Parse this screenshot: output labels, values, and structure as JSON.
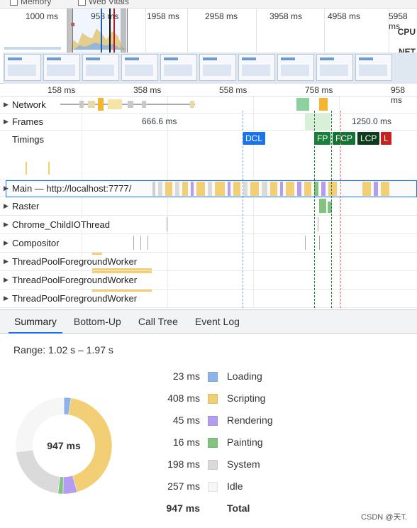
{
  "top_options": {
    "memory": "Memory",
    "web_vitals": "Web Vitals"
  },
  "overview": {
    "ticks": [
      "1000 ms",
      "958 ms",
      "1958 ms",
      "2958 ms",
      "3958 ms",
      "4958 ms",
      "5958 ms"
    ],
    "cpu_label": "CPU",
    "net_label": "NET"
  },
  "ruler": [
    "158 ms",
    "358 ms",
    "558 ms",
    "758 ms",
    "958 ms"
  ],
  "tracks": {
    "network": "Network",
    "frames": "Frames",
    "frames_time_1": "666.6 ms",
    "frames_time_2": "1250.0 ms",
    "timings": "Timings",
    "main": "Main — http://localhost:7777/",
    "raster": "Raster",
    "chrome_child": "Chrome_ChildIOThread",
    "compositor": "Compositor",
    "pool_1": "ThreadPoolForegroundWorker",
    "pool_2": "ThreadPoolForegroundWorker",
    "pool_3": "ThreadPoolForegroundWorker"
  },
  "markers": {
    "dcl": "DCL",
    "fp": "FP",
    "fcp": "FCP",
    "lcp": "LCP",
    "l": "L"
  },
  "tabs": [
    "Summary",
    "Bottom-Up",
    "Call Tree",
    "Event Log"
  ],
  "summary": {
    "range": "Range: 1.02 s – 1.97 s",
    "total_center": "947 ms",
    "rows": [
      {
        "value": "23 ms",
        "name": "Loading",
        "color": "#8cb4e6"
      },
      {
        "value": "408 ms",
        "name": "Scripting",
        "color": "#f2cf75"
      },
      {
        "value": "45 ms",
        "name": "Rendering",
        "color": "#b49cf0"
      },
      {
        "value": "16 ms",
        "name": "Painting",
        "color": "#84c281"
      },
      {
        "value": "198 ms",
        "name": "System",
        "color": "#dadada"
      },
      {
        "value": "257 ms",
        "name": "Idle",
        "color": "#f6f6f6"
      },
      {
        "value": "947 ms",
        "name": "Total",
        "color": ""
      }
    ]
  },
  "watermark": "CSDN @天T."
}
